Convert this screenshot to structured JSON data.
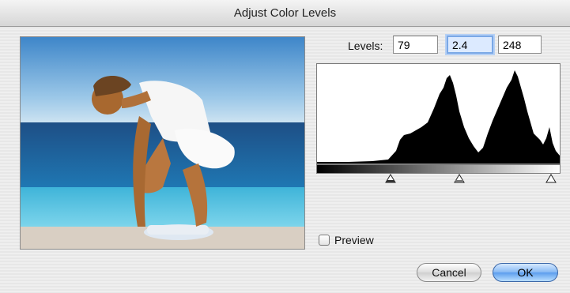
{
  "dialog": {
    "title": "Adjust Color Levels"
  },
  "levels": {
    "label": "Levels:",
    "black_point": "79",
    "gamma": "2.4",
    "white_point": "248"
  },
  "preview": {
    "label": "Preview",
    "checked": false
  },
  "buttons": {
    "cancel": "Cancel",
    "ok": "OK"
  },
  "colors": {
    "histogram_fill": "#000000",
    "default_button": "#5b9ded",
    "focus_ring": "#7aa8e6"
  },
  "icons": {
    "slider_black": "triangle-slider-icon",
    "slider_gamma": "triangle-slider-icon",
    "slider_white": "triangle-slider-icon"
  }
}
